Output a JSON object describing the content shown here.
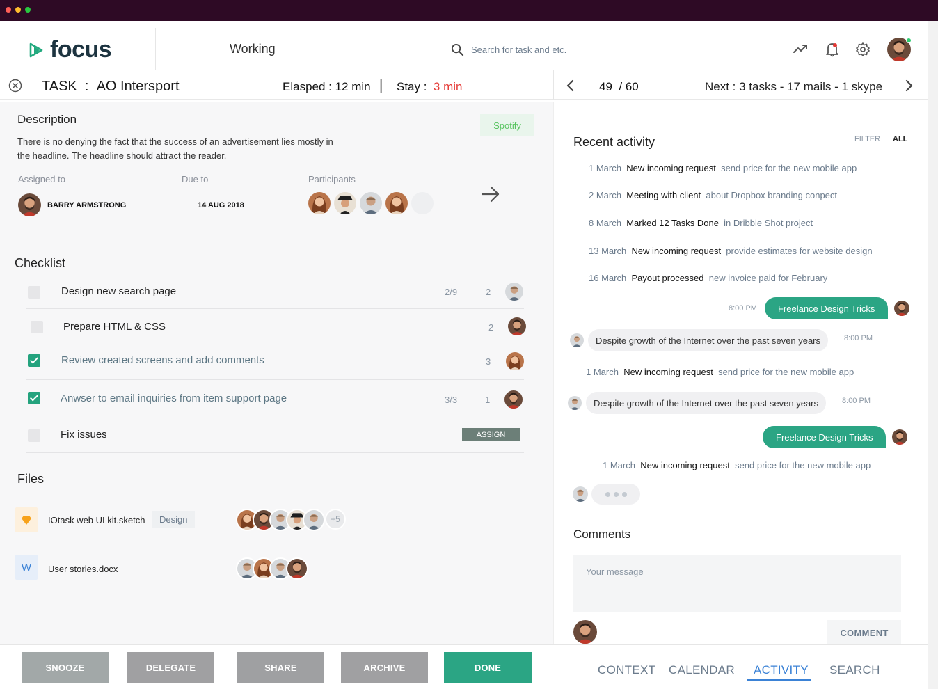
{
  "colors": {
    "titlebar": "#2e0a25",
    "accent_green": "#2ba584",
    "accent_blue": "#3b82d6",
    "danger_red": "#e53935"
  },
  "header": {
    "brand": "focus",
    "title": "Working",
    "search_placeholder": "Search for task and etc.",
    "icons": [
      "trend-icon",
      "bell-icon",
      "gear-icon",
      "avatar"
    ]
  },
  "taskbar": {
    "task_prefix": "TASK",
    "task_colon": ":",
    "task_name": "AO Intersport",
    "elapsed": "Elasped : 12 min",
    "separator": "|",
    "stay_label": "Stay :",
    "stay_value": "3 min",
    "current": "49",
    "total": "/ 60",
    "next": "Next : 3 tasks - 17 mails - 1 skype"
  },
  "description": {
    "title": "Description",
    "tag": "Spotify",
    "text": "There is no denying the fact that the success of an advertisement lies mostly in the headline. The headline should attract the reader.",
    "assigned_label": "Assigned to",
    "assigned_name": "BARRY ARMSTRONG",
    "due_label": "Due to",
    "due_date": "14 AUG 2018",
    "participants_label": "Participants"
  },
  "checklist": {
    "title": "Checklist",
    "items": [
      {
        "label": "Design new search page",
        "progress": "2/9",
        "comments": "2",
        "checked": false
      },
      {
        "label": "Prepare HTML & CSS",
        "progress": "",
        "comments": "2",
        "checked": false
      },
      {
        "label": "Review created screens and add comments",
        "progress": "",
        "comments": "3",
        "checked": true
      },
      {
        "label": "Anwser to email inquiries from item support page",
        "progress": "3/3",
        "comments": "1",
        "checked": true
      },
      {
        "label": "Fix issues",
        "progress": "",
        "comments": "",
        "checked": false,
        "action": "ASSIGN"
      }
    ]
  },
  "files": {
    "title": "Files",
    "items": [
      {
        "name": "IOtask web UI kit.sketch",
        "tag": "Design",
        "more": "+5",
        "icon_letter": ""
      },
      {
        "name": "User stories.docx",
        "tag": "",
        "more": "",
        "icon_letter": "W"
      }
    ]
  },
  "activity": {
    "title": "Recent activity",
    "filter": "FILTER",
    "all": "ALL",
    "entries": [
      {
        "date": "1 March",
        "event": "New incoming request",
        "detail": "send price for the new mobile app"
      },
      {
        "date": "2 March",
        "event": "Meeting with client",
        "detail": "about Dropbox branding conpect"
      },
      {
        "date": "8 March",
        "event": "Marked 12 Tasks Done",
        "detail": "in Dribble Shot project"
      },
      {
        "date": "13 March",
        "event": "New incoming request",
        "detail": "provide estimates for website design"
      },
      {
        "date": "16 March",
        "event": "Payout processed",
        "detail": "new invoice paid for February"
      },
      {
        "date": "1 March",
        "event": "New incoming request",
        "detail": "send price for the new mobile app"
      },
      {
        "date": "1 March",
        "event": "New incoming request",
        "detail": "send price for the new mobile app"
      }
    ],
    "messages": [
      {
        "text": "Freelance Design Tricks",
        "time": "8:00 PM"
      },
      {
        "text": "Despite growth of the Internet over the past seven years",
        "time": "8:00 PM"
      },
      {
        "text": "Despite growth of the Internet over the past seven years",
        "time": "8:00 PM"
      },
      {
        "text": "Freelance Design Tricks",
        "time": ""
      }
    ]
  },
  "comments": {
    "title": "Comments",
    "placeholder": "Your message",
    "button": "COMMENT"
  },
  "footer": {
    "actions": [
      "SNOOZE",
      "DELEGATE",
      "SHARE",
      "ARCHIVE",
      "DONE"
    ],
    "tabs": [
      "CONTEXT",
      "CALENDAR",
      "ACTIVITY",
      "SEARCH"
    ],
    "active_tab": "ACTIVITY"
  }
}
